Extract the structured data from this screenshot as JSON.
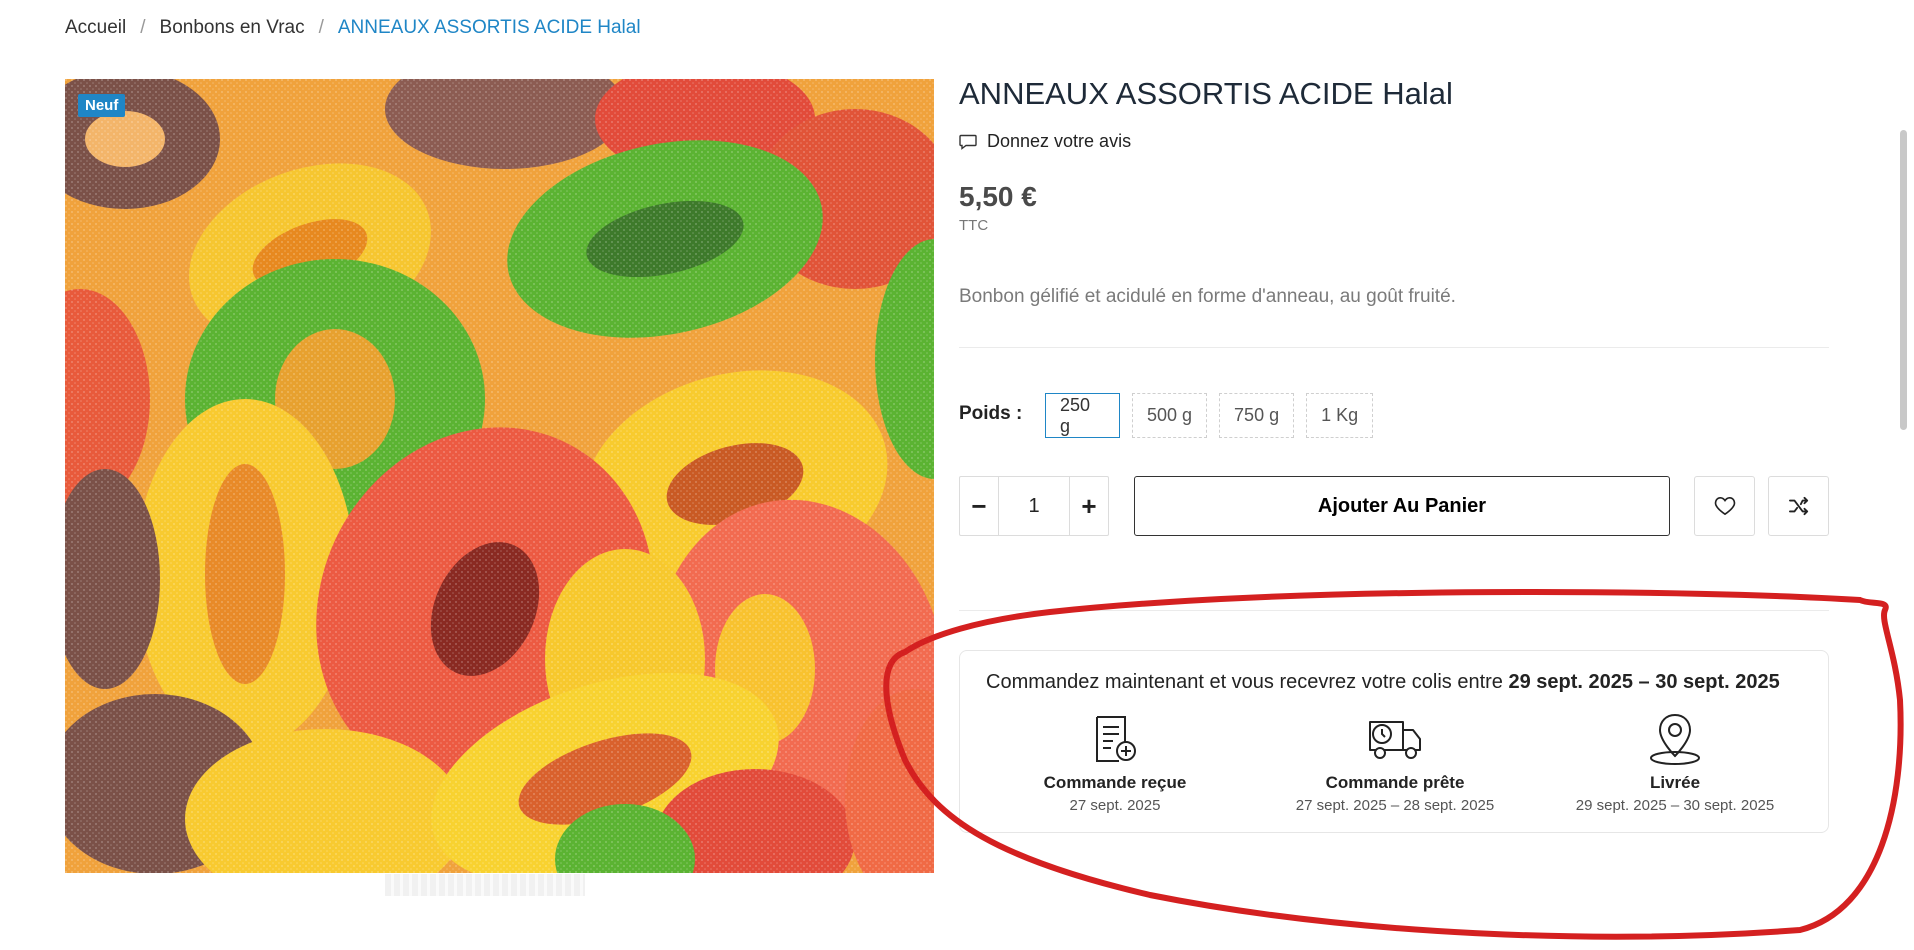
{
  "breadcrumb": {
    "home": "Accueil",
    "category": "Bonbons en Vrac",
    "current": "ANNEAUX ASSORTIS ACIDE Halal",
    "separator": "/"
  },
  "badge": "Neuf",
  "product": {
    "title": "ANNEAUX ASSORTIS ACIDE Halal",
    "review_label": "Donnez votre avis",
    "price": "5,50 €",
    "tax_label": "TTC",
    "description": "Bonbon gélifié et acidulé en forme d'anneau, au goût fruité."
  },
  "weight": {
    "label": "Poids :",
    "options": [
      "250 g",
      "500 g",
      "750 g",
      "1 Kg"
    ],
    "selected": "250 g"
  },
  "quantity": {
    "minus": "−",
    "value": "1",
    "plus": "+"
  },
  "add_to_cart": "Ajouter Au Panier",
  "delivery": {
    "intro": "Commandez maintenant et vous recevrez votre colis entre ",
    "range": "29 sept. 2025 – 30 sept. 2025",
    "steps": [
      {
        "label": "Commande reçue",
        "date": "27 sept. 2025",
        "icon": "order-received-icon"
      },
      {
        "label": "Commande prête",
        "date": "27 sept. 2025 – 28 sept. 2025",
        "icon": "delivery-truck-icon"
      },
      {
        "label": "Livrée",
        "date": "29 sept. 2025 – 30 sept. 2025",
        "icon": "location-pin-icon"
      }
    ]
  },
  "colors": {
    "accent": "#1f86c6",
    "annotation": "#d42020"
  }
}
